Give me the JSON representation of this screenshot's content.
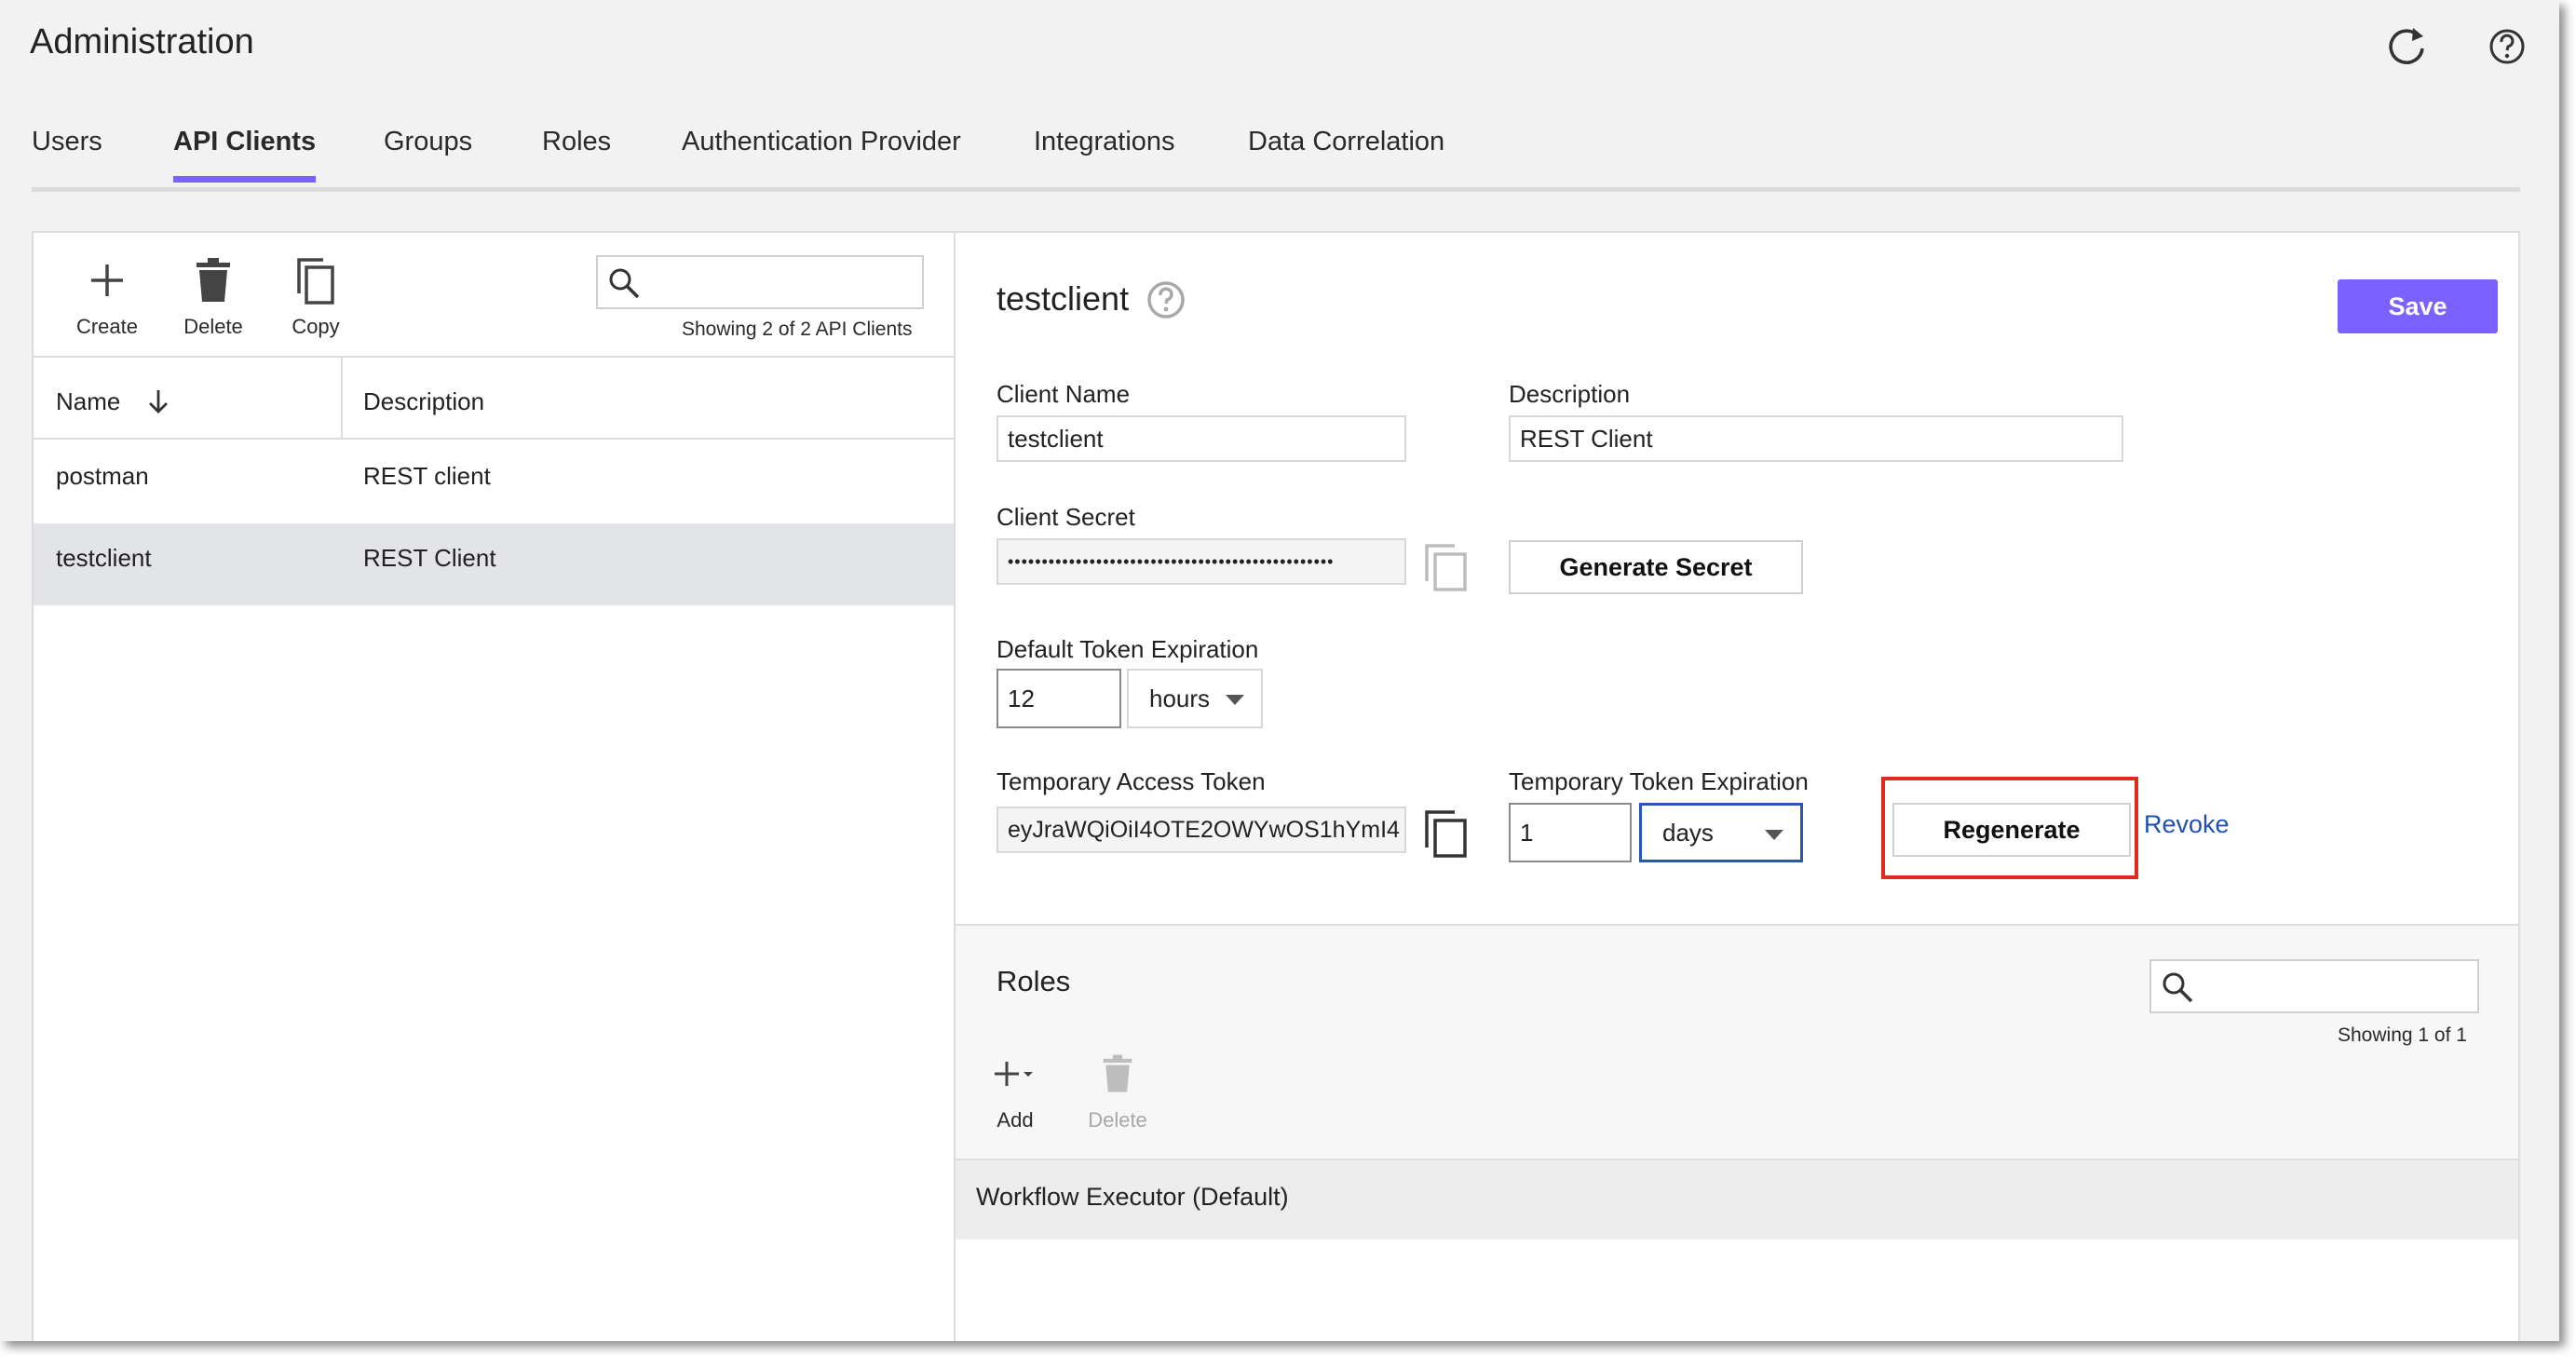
{
  "app": {
    "title": "Administration"
  },
  "tabs": [
    {
      "label": "Users"
    },
    {
      "label": "API Clients"
    },
    {
      "label": "Groups"
    },
    {
      "label": "Roles"
    },
    {
      "label": "Authentication Provider"
    },
    {
      "label": "Integrations"
    },
    {
      "label": "Data Correlation"
    }
  ],
  "active_tab": "API Clients",
  "list": {
    "toolbar": {
      "create": "Create",
      "delete": "Delete",
      "copy": "Copy"
    },
    "search": {
      "value": ""
    },
    "showing": "Showing 2 of 2 API Clients",
    "columns": {
      "name": "Name",
      "description": "Description"
    },
    "rows": [
      {
        "name": "postman",
        "description": "REST client"
      },
      {
        "name": "testclient",
        "description": "REST Client"
      }
    ],
    "selected": "testclient"
  },
  "detail": {
    "title": "testclient",
    "save": "Save",
    "client_name": {
      "label": "Client Name",
      "value": "testclient"
    },
    "description": {
      "label": "Description",
      "value": "REST Client"
    },
    "client_secret": {
      "label": "Client Secret",
      "value": "••••••••••••••••••••••••••••••••••••••••••••••••"
    },
    "generate_secret": "Generate Secret",
    "default_token_expiration": {
      "label": "Default Token Expiration",
      "value": "12",
      "unit": "hours"
    },
    "temporary_access_token": {
      "label": "Temporary Access Token",
      "value": "eyJraWQiOiI4OTE2OWYwOS1hYmI4"
    },
    "temporary_token_expiration": {
      "label": "Temporary Token Expiration",
      "value": "1",
      "unit": "days"
    },
    "regenerate": "Regenerate",
    "revoke": "Revoke"
  },
  "roles": {
    "title": "Roles",
    "search": {
      "value": ""
    },
    "showing": "Showing 1 of 1",
    "toolbar": {
      "add": "Add",
      "delete": "Delete"
    },
    "items": [
      {
        "name": "Workflow Executor (Default)"
      }
    ]
  },
  "colors": {
    "accent": "#7b61ff",
    "highlight": "#e02a1f",
    "link": "#1f4fb0"
  }
}
